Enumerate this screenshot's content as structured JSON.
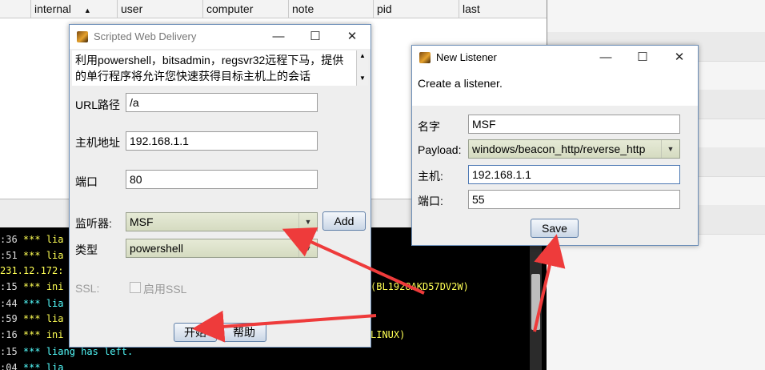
{
  "background": {
    "table_columns": [
      "internal",
      "user",
      "computer",
      "note",
      "pid",
      "last"
    ],
    "console_lines": [
      {
        "ts": ":36",
        "text": "*** lia",
        "color": "#ffff54"
      },
      {
        "ts": ":51",
        "text": "*** lia",
        "color": "#ffff54"
      },
      {
        "ts": "231.12.172:",
        "text": "",
        "color": "#ffff54"
      },
      {
        "ts": ":15",
        "text": "*** ini",
        "color": "#ffff54"
      },
      {
        "ts": ":44",
        "text": "*** lia",
        "color": "#ffff54"
      },
      {
        "ts": ":59",
        "text": "*** lia",
        "color": "#ffff54"
      },
      {
        "ts": ":16",
        "text": "*** ini",
        "color": "#ffff54"
      },
      {
        "ts": ":15",
        "text": "*** liang has left.",
        "color": "#54ffff"
      },
      {
        "ts": ":04",
        "text": "*** lia",
        "color": "#54ffff"
      }
    ],
    "console_fragments": [
      "(BL1928AKD57DV2W)",
      "LINUX)"
    ]
  },
  "swd": {
    "title": "Scripted Web Delivery",
    "minimize": "—",
    "maximize": "☐",
    "close": "✕",
    "description": "利用powershell，bitsadmin，regsvr32远程下马，提供的单行程序将允许您快速获得目标主机上的会话",
    "url_label": "URL路径",
    "url_value": "/a",
    "host_label": "主机地址",
    "host_value": "192.168.1.1",
    "port_label": "端口",
    "port_value": "80",
    "listener_label": "监听器:",
    "listener_value": "MSF",
    "add_label": "Add",
    "type_label": "类型",
    "type_value": "powershell",
    "ssl_label": "SSL:",
    "ssl_checkbox_label": "启用SSL",
    "start_label": "开始",
    "help_label": "帮助"
  },
  "listener": {
    "title": "New Listener",
    "minimize": "—",
    "maximize": "☐",
    "close": "✕",
    "intro": "Create a listener.",
    "name_label": "名字",
    "name_value": "MSF",
    "payload_label": "Payload:",
    "payload_value": "windows/beacon_http/reverse_http",
    "host_label": "主机:",
    "host_value": "192.168.1.1",
    "port_label": "端口:",
    "port_value": "55",
    "save_label": "Save"
  },
  "colors": {
    "annotation_arrow": "#ee3b3b",
    "dialog_border": "#6d8fb8",
    "console_bg": "#000000"
  }
}
